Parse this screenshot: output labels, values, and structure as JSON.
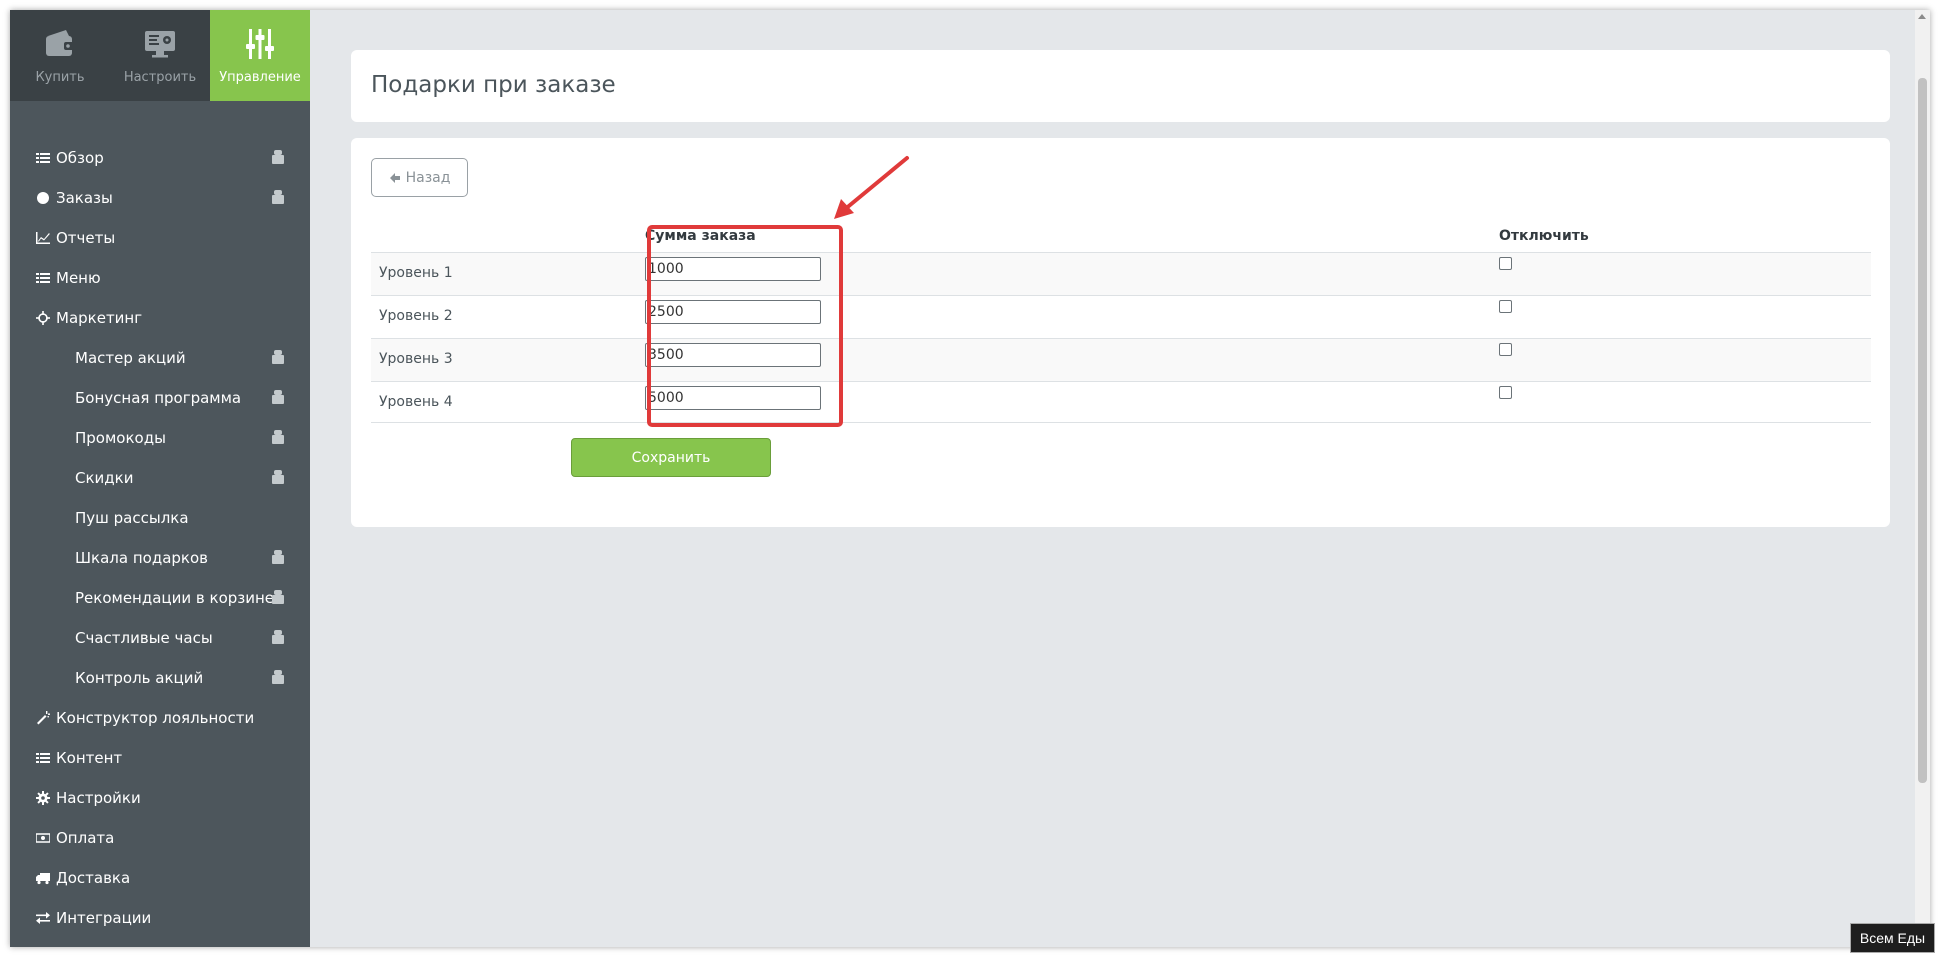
{
  "top_tabs": [
    {
      "label": "Купить",
      "icon": "wallet-icon",
      "active": false
    },
    {
      "label": "Настроить",
      "icon": "monitor-gear-icon",
      "active": false
    },
    {
      "label": "Управление",
      "icon": "sliders-icon",
      "active": true
    }
  ],
  "sidebar": {
    "items": [
      {
        "label": "Обзор",
        "icon": "list-icon",
        "locked": true,
        "sub": false
      },
      {
        "label": "Заказы",
        "icon": "circle-icon",
        "locked": true,
        "sub": false
      },
      {
        "label": "Отчеты",
        "icon": "chart-line-icon",
        "locked": false,
        "sub": false
      },
      {
        "label": "Меню",
        "icon": "list-icon",
        "locked": false,
        "sub": false
      },
      {
        "label": "Маркетинг",
        "icon": "crosshair-icon",
        "locked": false,
        "sub": false
      },
      {
        "label": "Мастер акций",
        "locked": true,
        "sub": true
      },
      {
        "label": "Бонусная программа",
        "locked": true,
        "sub": true
      },
      {
        "label": "Промокоды",
        "locked": true,
        "sub": true
      },
      {
        "label": "Скидки",
        "locked": true,
        "sub": true
      },
      {
        "label": "Пуш рассылка",
        "locked": false,
        "sub": true
      },
      {
        "label": "Шкала подарков",
        "locked": true,
        "sub": true
      },
      {
        "label": "Рекомендации в корзине",
        "locked": true,
        "sub": true
      },
      {
        "label": "Счастливые часы",
        "locked": true,
        "sub": true
      },
      {
        "label": "Контроль акций",
        "locked": true,
        "sub": true
      },
      {
        "label": "Конструктор лояльности",
        "icon": "magic-wand-icon",
        "locked": false,
        "sub": false
      },
      {
        "label": "Контент",
        "icon": "list-icon",
        "locked": false,
        "sub": false
      },
      {
        "label": "Настройки",
        "icon": "gear-icon",
        "locked": false,
        "sub": false
      },
      {
        "label": "Оплата",
        "icon": "money-icon",
        "locked": false,
        "sub": false
      },
      {
        "label": "Доставка",
        "icon": "truck-icon",
        "locked": false,
        "sub": false
      },
      {
        "label": "Интеграции",
        "icon": "exchange-icon",
        "locked": false,
        "sub": false
      }
    ]
  },
  "page": {
    "title": "Подарки при заказе",
    "back_label": "Назад",
    "col_sum": "Сумма заказа",
    "col_disable": "Отключить",
    "save_label": "Сохранить"
  },
  "levels": [
    {
      "label": "Уровень 1",
      "value": "1000",
      "disabled": false
    },
    {
      "label": "Уровень 2",
      "value": "2500",
      "disabled": false
    },
    {
      "label": "Уровень 3",
      "value": "3500",
      "disabled": false
    },
    {
      "label": "Уровень 4",
      "value": "5000",
      "disabled": false
    }
  ],
  "tooltip": "Всем Еды",
  "colors": {
    "sidebar_bg": "#4d565c",
    "tabs_bg": "#3a4145",
    "accent_green": "#87c54d",
    "highlight_red": "#e03a3a",
    "page_bg": "#e4e7ea"
  }
}
